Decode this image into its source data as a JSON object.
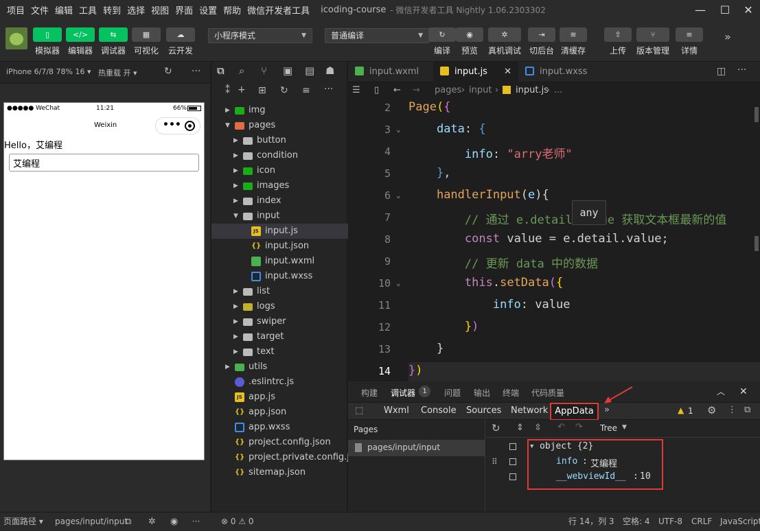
{
  "menu": {
    "items": [
      "项目",
      "文件",
      "编辑",
      "工具",
      "转到",
      "选择",
      "视图",
      "界面",
      "设置",
      "帮助",
      "微信开发者工具"
    ],
    "title": "icoding-course",
    "subtitle": "- 微信开发者工具 Nightly 1.06.2303302"
  },
  "toolbar": {
    "simulator": "模拟器",
    "editor": "编辑器",
    "debugger": "调试器",
    "visual": "可视化",
    "cloud": "云开发",
    "mode_select": "小程序模式",
    "compile_select": "普通编译",
    "compile": "编译",
    "preview": "预览",
    "remote_debug": "真机调试",
    "background": "切后台",
    "clear_cache": "清缓存",
    "upload": "上传",
    "version": "版本管理",
    "details": "详情"
  },
  "simulator": {
    "device": "iPhone 6/7/8 78% 16 ▾",
    "hot_reload": "热重载 开 ▾",
    "status_left": "●●●●● WeChat",
    "status_time": "11:21",
    "status_battery": "66%",
    "nav_title": "Weixin",
    "hello_text": "Hello，艾编程",
    "input_value": "艾编程"
  },
  "explorer": {
    "items": [
      {
        "label": "img"
      },
      {
        "label": "pages"
      },
      {
        "label": "button"
      },
      {
        "label": "condition"
      },
      {
        "label": "icon"
      },
      {
        "label": "images"
      },
      {
        "label": "index"
      },
      {
        "label": "input"
      },
      {
        "label": "input.js"
      },
      {
        "label": "input.json"
      },
      {
        "label": "input.wxml"
      },
      {
        "label": "input.wxss"
      },
      {
        "label": "list"
      },
      {
        "label": "logs"
      },
      {
        "label": "swiper"
      },
      {
        "label": "target"
      },
      {
        "label": "text"
      },
      {
        "label": "utils"
      },
      {
        "label": ".eslintrc.js"
      },
      {
        "label": "app.js"
      },
      {
        "label": "app.json"
      },
      {
        "label": "app.wxss"
      },
      {
        "label": "project.config.json"
      },
      {
        "label": "project.private.config.js..."
      },
      {
        "label": "sitemap.json"
      }
    ]
  },
  "editor": {
    "tabs": [
      "input.wxml",
      "input.js",
      "input.wxss"
    ],
    "breadcrumb": [
      "pages",
      "input",
      "input.js",
      "..."
    ],
    "hover_tip": "any",
    "line_numbers": [
      "2",
      "3",
      "4",
      "5",
      "6",
      "7",
      "8",
      "9",
      "10",
      "11",
      "12",
      "13",
      "14"
    ]
  },
  "panel": {
    "tabs": [
      "构建",
      "调试器",
      "问题",
      "输出",
      "终端",
      "代码质量"
    ],
    "debugger_badge": "1",
    "devtools_tabs": [
      "Wxml",
      "Console",
      "Sources",
      "Network",
      "AppData"
    ],
    "warning_count": "1",
    "pages_header": "Pages",
    "pages_item": "pages/input/input",
    "tree_mode": "Tree",
    "appdata": {
      "root": "object {2}",
      "key1": "info",
      "val1": "艾编程",
      "key2": "__webviewId__",
      "val2": "10"
    }
  },
  "statusbar": {
    "page_path": "页面路径 ▾",
    "path": "pages/input/input",
    "errors": "⊗ 0 ⚠ 0",
    "position": "行 14，列 3",
    "spaces": "空格: 4",
    "encoding": "UTF-8",
    "eol": "CRLF",
    "language": "JavaScript"
  },
  "colors": {
    "accent_green": "#07c160",
    "highlight_red": "#e53935"
  }
}
